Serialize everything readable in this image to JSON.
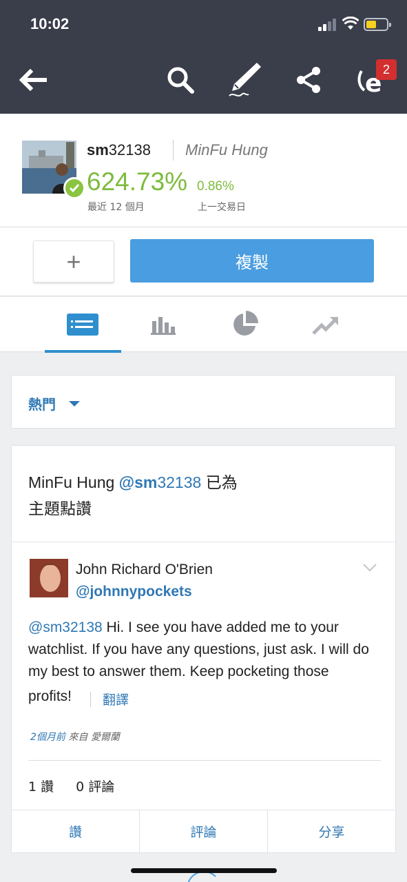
{
  "status_bar": {
    "time": "10:02"
  },
  "nav": {
    "icons": [
      "back-arrow-icon",
      "search-icon",
      "pencil-icon",
      "share-icon",
      "etoro-notifications-icon"
    ],
    "notification_count": "2"
  },
  "profile": {
    "username_bold": "sm",
    "username_rest": "32138",
    "full_name": "MinFu Hung",
    "gain": "624.73%",
    "gain_label": "最近 12 個月",
    "daily_change": "0.86%",
    "daily_label": "上一交易日",
    "accent": "#7dbb3c"
  },
  "actions": {
    "add_label": "+",
    "copy_label": "複製",
    "copy_color": "#4a9de0"
  },
  "tabs": [
    {
      "icon": "feed-icon",
      "active": true
    },
    {
      "icon": "bar-chart-icon",
      "active": false
    },
    {
      "icon": "pie-chart-icon",
      "active": false
    },
    {
      "icon": "trend-up-icon",
      "active": false
    }
  ],
  "filter": {
    "label": "熱門"
  },
  "post": {
    "activity_name": "MinFu Hung",
    "activity_mention_bold": "@sm",
    "activity_mention_rest": "32138",
    "activity_action": " 已為",
    "activity_line2": "主題點讚",
    "author_name": "John Richard O'Brien",
    "author_handle": "@johnnypockets",
    "body_mention": "@sm32138",
    "body_text": " Hi. I see you have added me to your watchlist. If you have any questions, just ask. I will do my best to answer them. Keep pocketing those",
    "body_last": "profits!",
    "translate": "翻譯",
    "time_ago": "2個月前",
    "location": " 來自 愛爾蘭",
    "likes": "1 讚",
    "comments": "0 評論",
    "buttons": {
      "like": "讚",
      "comment": "評論",
      "share": "分享"
    }
  }
}
